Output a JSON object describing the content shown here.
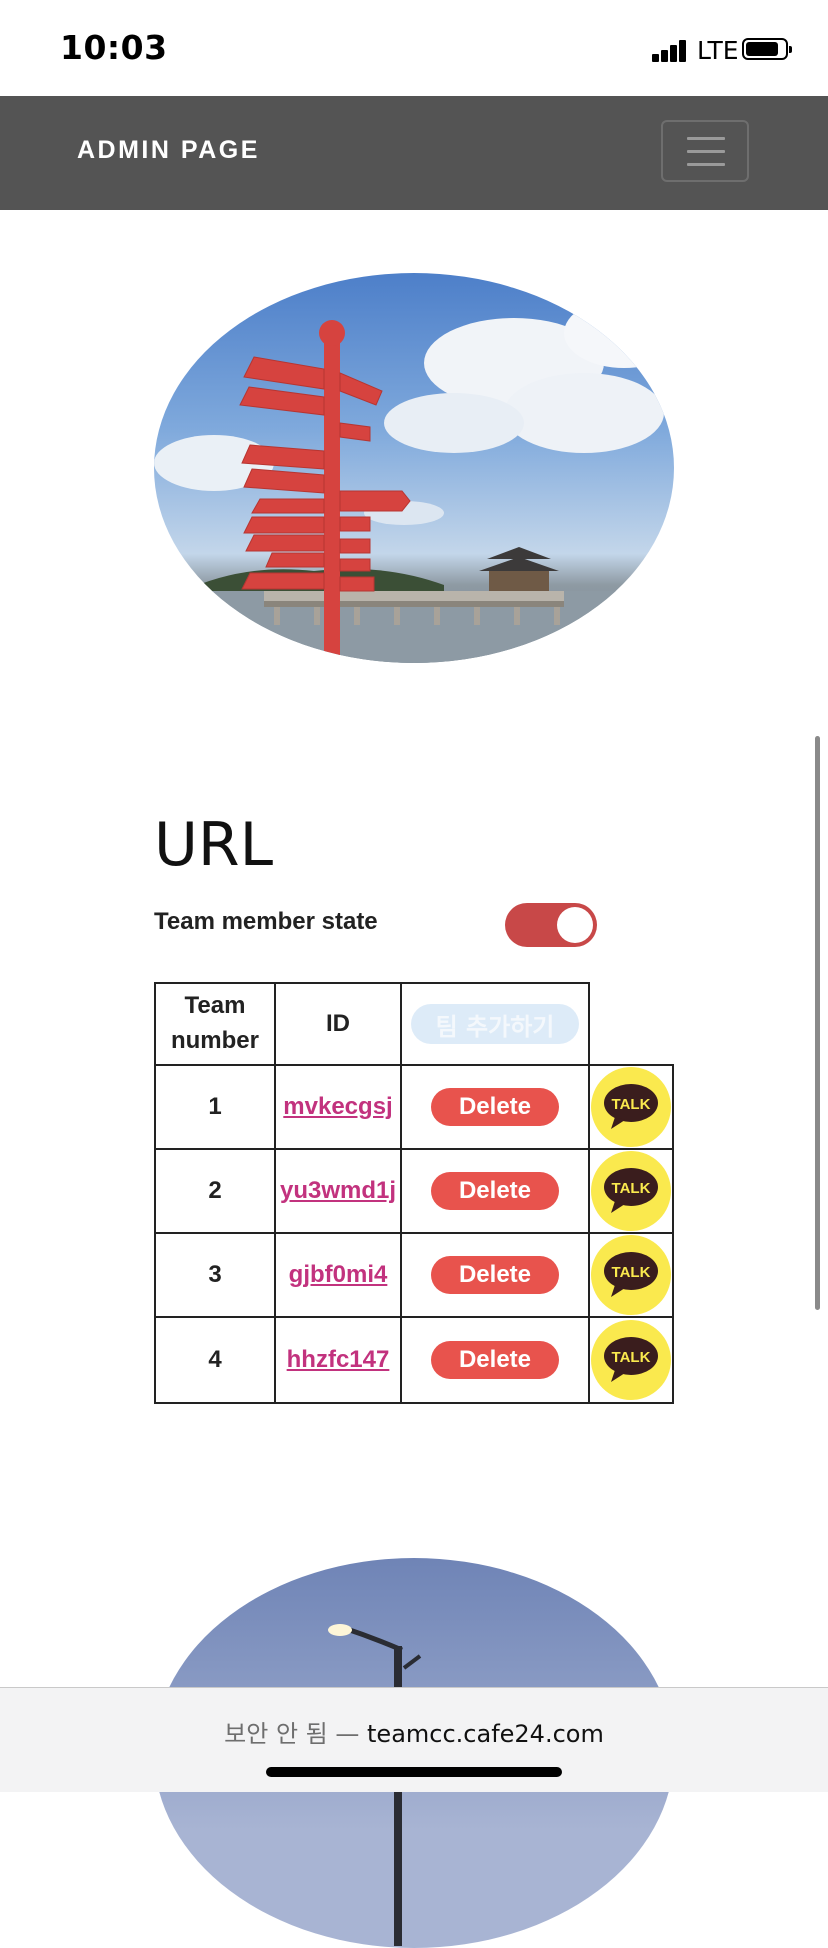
{
  "status_bar": {
    "time": "10:03",
    "network": "LTE",
    "signal_bars": 4,
    "battery_level": 0.85
  },
  "navbar": {
    "brand": "ADMIN PAGE",
    "menu_icon": "hamburger-menu-icon"
  },
  "hero_images": [
    {
      "icon": "signpost-pier-photo"
    },
    {
      "icon": "streetlight-sky-photo"
    }
  ],
  "section": {
    "title": "URL",
    "state_label": "Team member state",
    "toggle_on": true
  },
  "table": {
    "headers": {
      "team_number": "Team number",
      "id": "ID",
      "add_button": "팀 추가하기"
    },
    "rows": [
      {
        "number": "1",
        "id": "mvkecgsj",
        "delete": "Delete",
        "talk": "TALK"
      },
      {
        "number": "2",
        "id": "yu3wmd1j",
        "delete": "Delete",
        "talk": "TALK"
      },
      {
        "number": "3",
        "id": "gjbf0mi4",
        "delete": "Delete",
        "talk": "TALK"
      },
      {
        "number": "4",
        "id": "hhzfc147",
        "delete": "Delete",
        "talk": "TALK"
      }
    ]
  },
  "address_bar": {
    "security": "보안 안 됨 —",
    "domain": "teamcc.cafe24.com"
  },
  "colors": {
    "navbar": "#545454",
    "toggle": "#c84848",
    "delete_button": "#e8534d",
    "link": "#c2327e",
    "talk_bubble": "#fae94e",
    "add_button": "#ddebf8"
  }
}
